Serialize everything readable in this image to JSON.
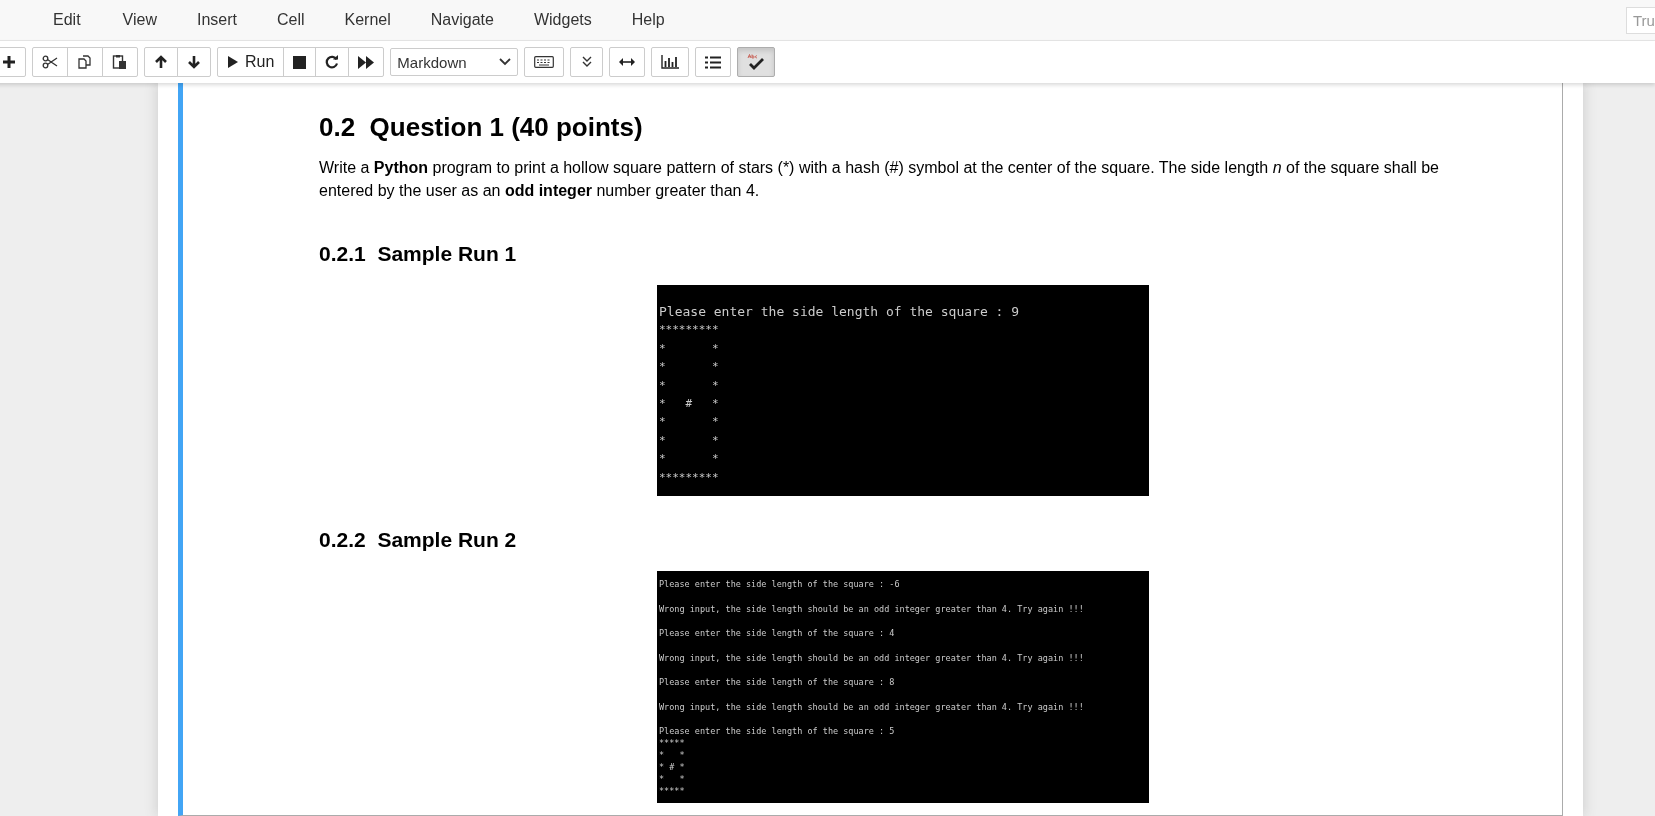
{
  "menu": [
    "Edit",
    "View",
    "Insert",
    "Cell",
    "Kernel",
    "Navigate",
    "Widgets",
    "Help"
  ],
  "trusted_field": "Tru",
  "toolbar": [
    [
      {
        "kind": "plus"
      }
    ],
    [
      {
        "kind": "scissors"
      },
      {
        "kind": "copy"
      },
      {
        "kind": "paste"
      }
    ],
    [
      {
        "kind": "up"
      },
      {
        "kind": "down"
      }
    ],
    [
      {
        "kind": "run",
        "label": "Run"
      },
      {
        "kind": "stop"
      },
      {
        "kind": "restart"
      },
      {
        "kind": "fastforward"
      }
    ],
    [
      {
        "kind": "select",
        "label": "Markdown"
      }
    ],
    [
      {
        "kind": "keyboard"
      }
    ],
    [
      {
        "kind": "chevrons"
      }
    ],
    [
      {
        "kind": "hresize"
      }
    ],
    [
      {
        "kind": "barchart"
      }
    ],
    [
      {
        "kind": "list"
      }
    ],
    [
      {
        "kind": "spellcheck",
        "on": true
      }
    ]
  ],
  "cell": {
    "heading": "0.2  Question 1 (40 points)",
    "paragraph": "Write a **Python** program to print a hollow square pattern of stars (*) with a hash (#) symbol at the center of the square. The side length *n* of the square shall be entered by the user as an **odd integer** number greater than 4.",
    "sections": [
      {
        "heading": "0.2.1  Sample Run 1",
        "console": {
          "messages": [
            "Please enter the side length of the square : 9"
          ],
          "pattern": "*********\n*       *\n*       *\n*       *\n*   #   *\n*       *\n*       *\n*       *\n*********"
        }
      },
      {
        "heading": "0.2.2  Sample Run 2",
        "console": {
          "messages": [
            "Please enter the side length of the square : -6",
            "Wrong input, the side length should be an odd integer greater than 4. Try again !!!",
            "Please enter the side length of the square : 4",
            "Wrong input, the side length should be an odd integer greater than 4. Try again !!!",
            "Please enter the side length of the square : 8",
            "Wrong input, the side length should be an odd integer greater than 4. Try again !!!",
            "Please enter the side length of the square : 5"
          ],
          "pattern": "*****\n*   *\n* # *\n*   *\n*****"
        }
      }
    ]
  }
}
